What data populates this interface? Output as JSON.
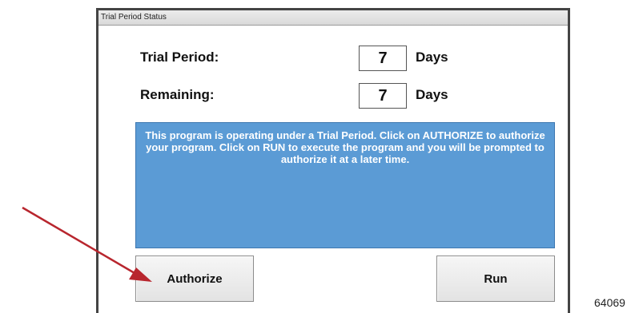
{
  "window": {
    "title": "Trial Period Status"
  },
  "trial_period": {
    "label": "Trial Period:",
    "value": "7",
    "unit": "Days"
  },
  "remaining": {
    "label": "Remaining:",
    "value": "7",
    "unit": "Days"
  },
  "message": "This program is operating under a Trial Period.  Click on AUTHORIZE to authorize your program. Click on RUN to execute the program and you will be prompted to authorize it at a later time.",
  "buttons": {
    "authorize": "Authorize",
    "run": "Run"
  },
  "figure_number": "64069",
  "annotation": {
    "arrow_color": "#b8262e",
    "points_to": "authorize-button"
  },
  "colors": {
    "message_background": "#5b9bd5"
  }
}
